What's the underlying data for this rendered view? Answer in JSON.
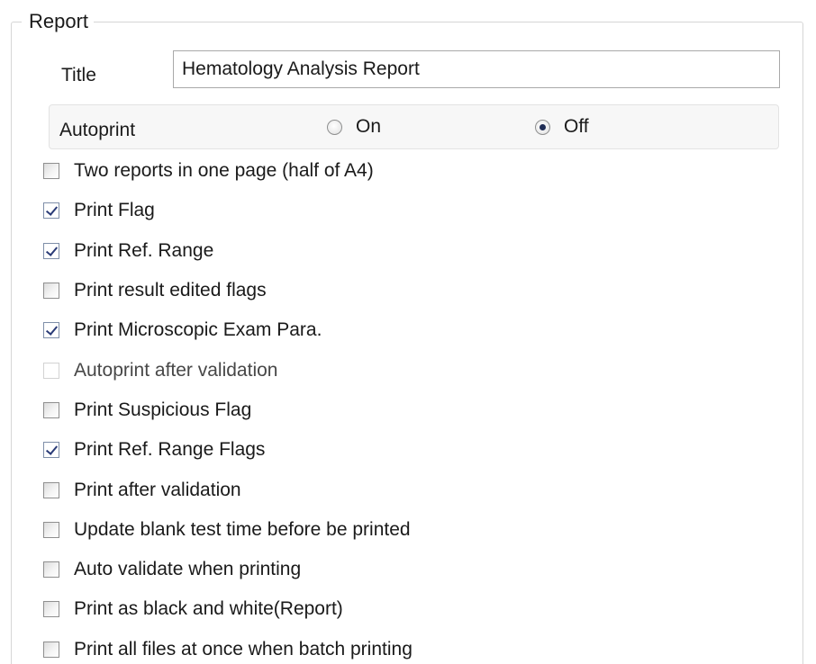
{
  "report": {
    "group_title": "Report",
    "title_label": "Title",
    "title_value": "Hematology Analysis Report",
    "autoprint": {
      "label": "Autoprint",
      "on_label": "On",
      "off_label": "Off",
      "selected": "Off"
    },
    "options": [
      {
        "label": "Two reports in one page (half of A4)",
        "checked": false,
        "enabled": true
      },
      {
        "label": "Print Flag",
        "checked": true,
        "enabled": true
      },
      {
        "label": "Print Ref. Range",
        "checked": true,
        "enabled": true
      },
      {
        "label": "Print result edited flags",
        "checked": false,
        "enabled": true
      },
      {
        "label": "Print Microscopic Exam Para.",
        "checked": true,
        "enabled": true
      },
      {
        "label": "Autoprint after validation",
        "checked": false,
        "enabled": false
      },
      {
        "label": "Print Suspicious Flag",
        "checked": false,
        "enabled": true
      },
      {
        "label": "Print Ref. Range Flags",
        "checked": true,
        "enabled": true
      },
      {
        "label": "Print after validation",
        "checked": false,
        "enabled": true
      },
      {
        "label": "Update blank test time before be printed",
        "checked": false,
        "enabled": true
      },
      {
        "label": "Auto validate when printing",
        "checked": false,
        "enabled": true
      },
      {
        "label": "Print as black and white(Report)",
        "checked": false,
        "enabled": true
      },
      {
        "label": "Print all files at once when batch printing",
        "checked": false,
        "enabled": true
      }
    ]
  }
}
